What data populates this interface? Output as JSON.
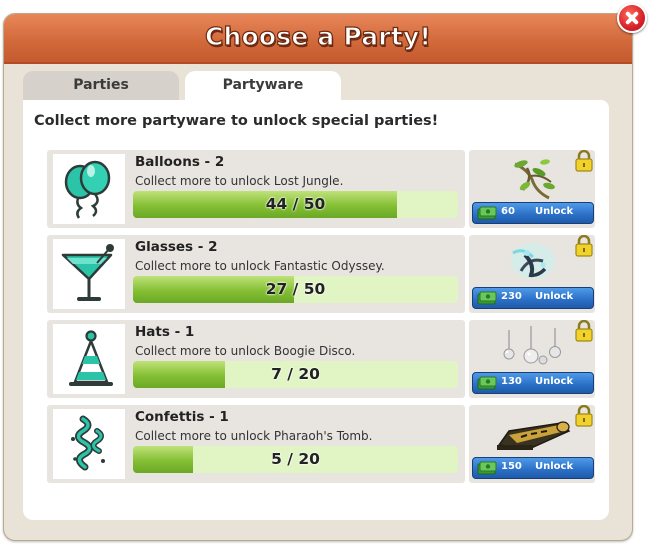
{
  "dialog": {
    "title": "Choose a Party!",
    "tabs": [
      {
        "label": "Parties",
        "active": false
      },
      {
        "label": "Partyware",
        "active": true
      }
    ],
    "instructions": "Collect more partyware to unlock special parties!"
  },
  "items": [
    {
      "name": "Balloons - 2",
      "description": "Collect more to unlock Lost Jungle.",
      "current": 44,
      "total": 50,
      "progress": "44 / 50",
      "price": "60",
      "unlock_label": "Unlock",
      "icon": "balloons-icon",
      "party_icon": "jungle-vines-icon"
    },
    {
      "name": "Glasses - 2",
      "description": "Collect more to unlock Fantastic Odyssey.",
      "current": 27,
      "total": 50,
      "progress": "27 / 50",
      "price": "230",
      "unlock_label": "Unlock",
      "icon": "cocktail-glass-icon",
      "party_icon": "odyssey-anchor-icon"
    },
    {
      "name": "Hats - 1",
      "description": "Collect more to unlock Boogie Disco.",
      "current": 7,
      "total": 20,
      "progress": "7 / 20",
      "price": "130",
      "unlock_label": "Unlock",
      "icon": "party-hat-icon",
      "party_icon": "disco-balls-icon"
    },
    {
      "name": "Confettis - 1",
      "description": "Collect more to unlock Pharaoh's Tomb.",
      "current": 5,
      "total": 20,
      "progress": "5 / 20",
      "price": "150",
      "unlock_label": "Unlock",
      "icon": "confetti-icon",
      "party_icon": "sarcophagus-icon"
    }
  ],
  "colors": {
    "title_bar": "#d26a3c",
    "progress_fill": "#84bf34",
    "progress_track": "#e0f4c4",
    "unlock_button": "#2a6fc6",
    "icon_teal": "#2bc4a8"
  }
}
